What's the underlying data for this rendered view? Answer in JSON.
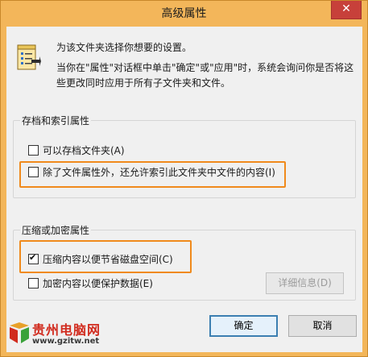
{
  "window": {
    "title": "高级属性",
    "close_glyph": "✕"
  },
  "intro": {
    "line1": "为该文件夹选择你想要的设置。",
    "line2": "当你在\"属性\"对话框中单击\"确定\"或\"应用\"时，系统会询问你是否将这些更改同时应用于所有子文件夹和文件。"
  },
  "archive_group": {
    "title": "存档和索引属性",
    "archive_label": "可以存档文件夹(A)",
    "archive_checked": false,
    "index_label": "除了文件属性外，还允许索引此文件夹中文件的内容(I)",
    "index_checked": false
  },
  "compress_group": {
    "title": "压缩或加密属性",
    "compress_label": "压缩内容以便节省磁盘空间(C)",
    "compress_checked": true,
    "encrypt_label": "加密内容以便保护数据(E)",
    "encrypt_checked": false,
    "details_button": "详细信息(D)"
  },
  "buttons": {
    "ok": "确定",
    "cancel": "取消"
  },
  "watermark": {
    "name": "贵州电脑网",
    "url": "www.gzitw.net"
  },
  "colors": {
    "frame": "#f3b65a",
    "highlight": "#f08a1c",
    "close": "#c7403a"
  }
}
